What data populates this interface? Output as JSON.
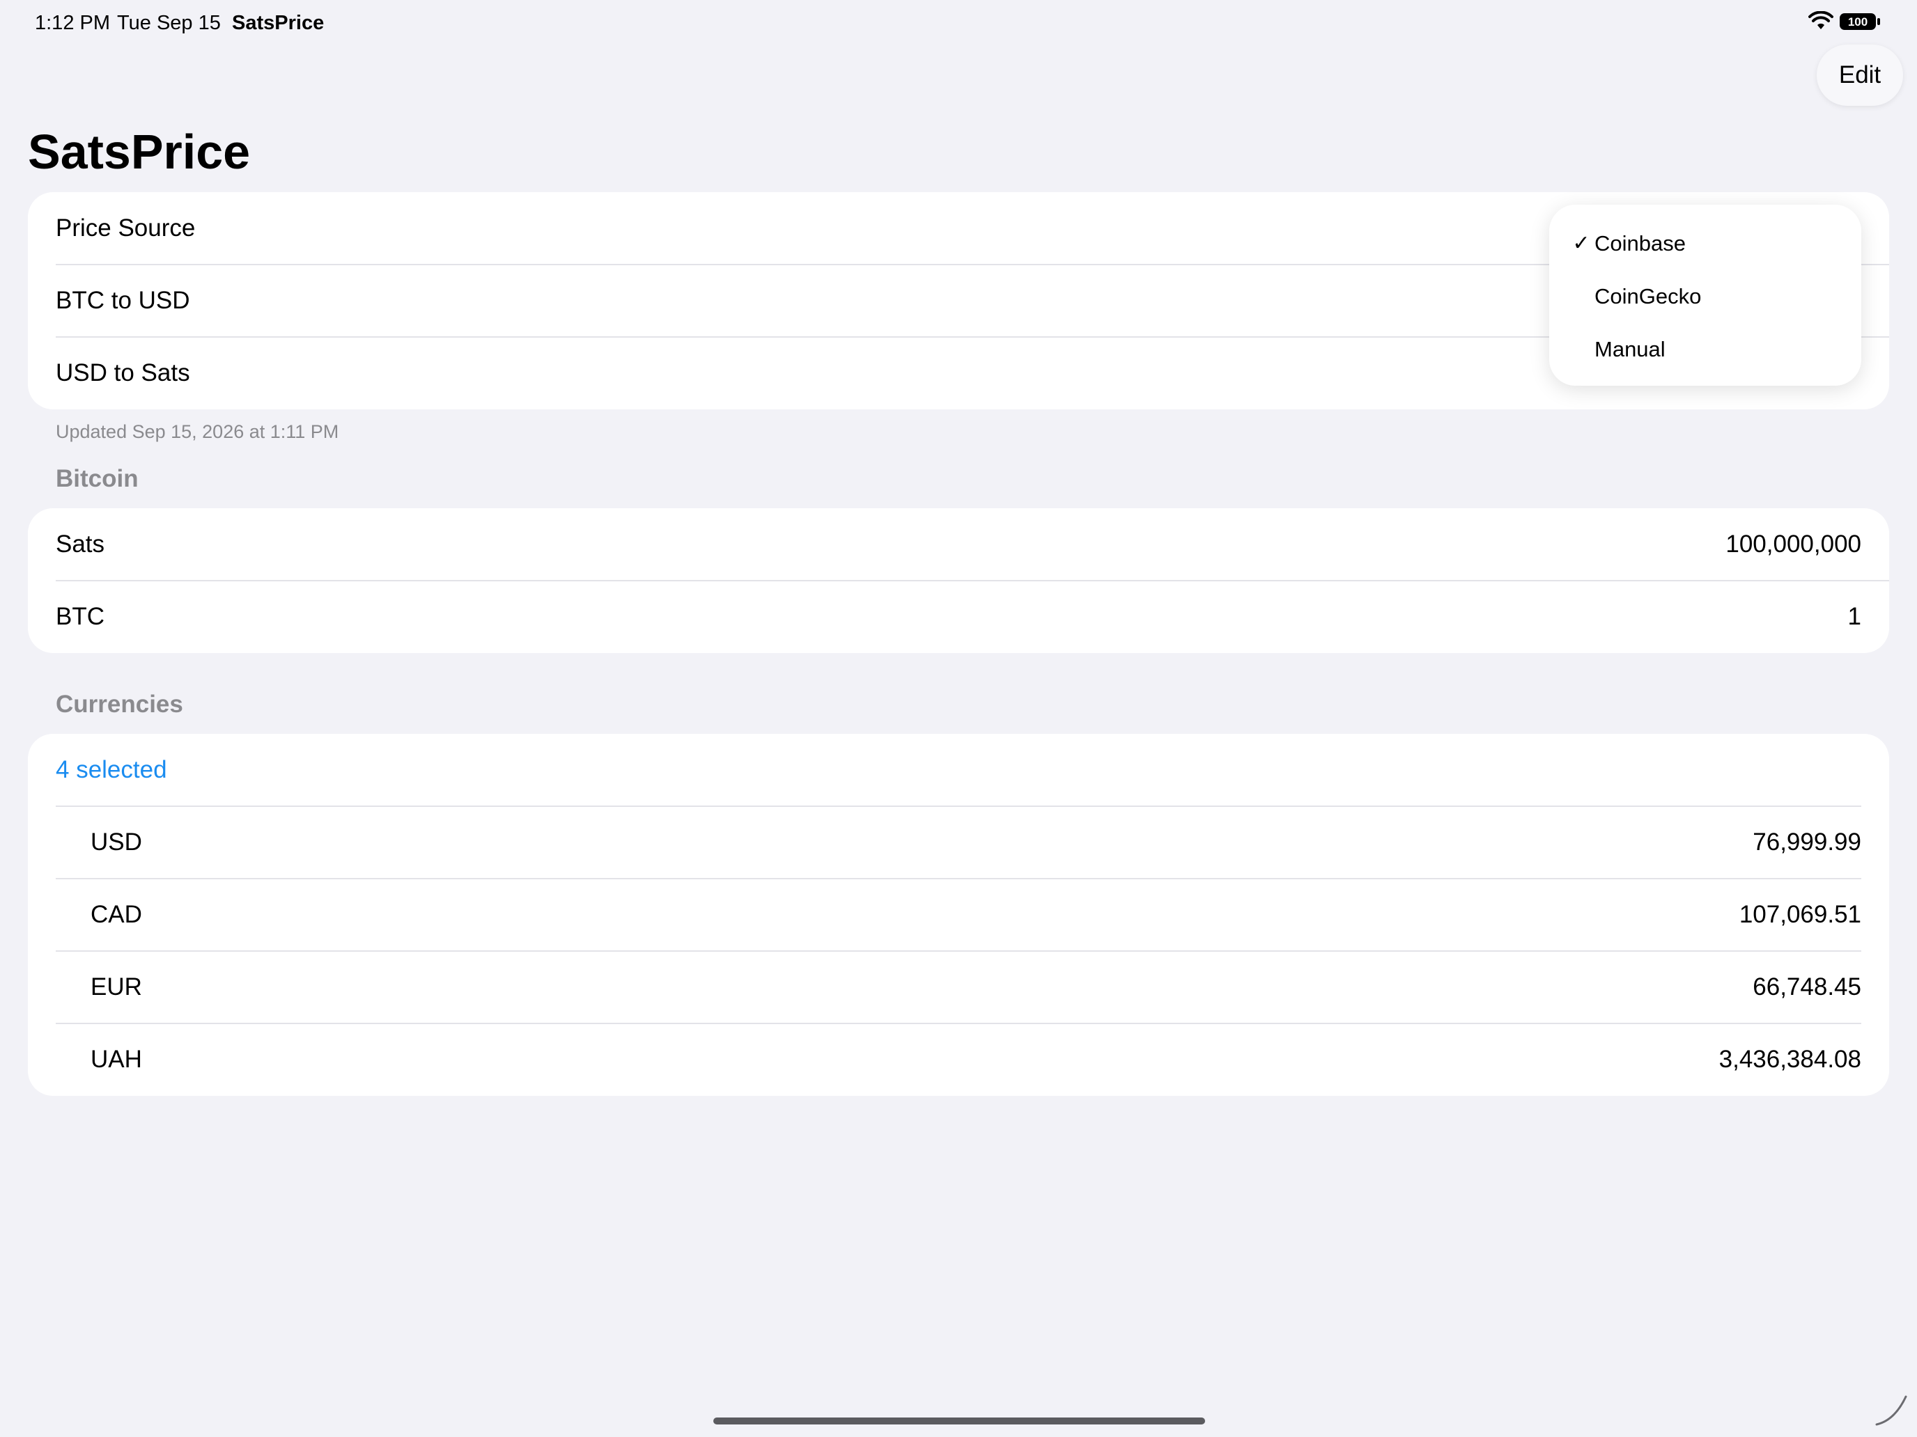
{
  "status_bar": {
    "time": "1:12 PM",
    "date": "Tue Sep 15",
    "app_name": "SatsPrice",
    "battery": "100"
  },
  "nav": {
    "edit_label": "Edit",
    "title": "SatsPrice"
  },
  "price_card": {
    "rows": [
      {
        "label": "Price Source"
      },
      {
        "label": "BTC to USD"
      },
      {
        "label": "USD to Sats"
      }
    ],
    "footer": "Updated Sep 15, 2026 at 1:11 PM"
  },
  "price_source_menu": {
    "items": [
      {
        "label": "Coinbase",
        "check": "✓",
        "selected": true
      },
      {
        "label": "CoinGecko",
        "check": "",
        "selected": false
      },
      {
        "label": "Manual",
        "check": "",
        "selected": false
      }
    ]
  },
  "bitcoin_section": {
    "header": "Bitcoin",
    "rows": [
      {
        "label": "Sats",
        "value": "100,000,000"
      },
      {
        "label": "BTC",
        "value": "1"
      }
    ]
  },
  "currencies_section": {
    "header": "Currencies",
    "selected_label": "4 selected",
    "rows": [
      {
        "code": "USD",
        "value": "76,999.99",
        "flag": "us-flag"
      },
      {
        "code": "CAD",
        "value": "107,069.51",
        "flag": "canada-flag"
      },
      {
        "code": "EUR",
        "value": "66,748.45",
        "flag": "eu-flag"
      },
      {
        "code": "UAH",
        "value": "3,436,384.08",
        "flag": "ukraine-flag"
      }
    ]
  },
  "colors": {
    "background": "#f2f2f7",
    "accent": "#1a8cf0",
    "secondary_text": "#8a8a8e"
  }
}
